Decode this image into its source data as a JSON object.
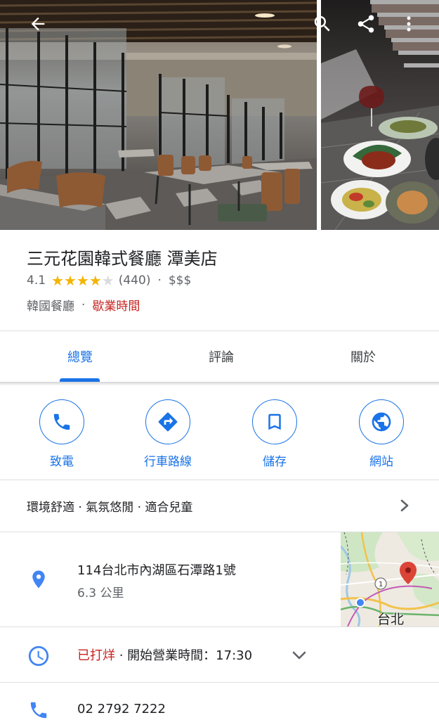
{
  "toolbar": {
    "back_icon": "arrow-back-icon",
    "search_icon": "search-icon",
    "share_icon": "share-icon",
    "more_icon": "more-vert-icon"
  },
  "place": {
    "name": "三元花園韓式餐廳 潭美店",
    "rating": "4.1",
    "stars_filled": 4,
    "reviews": "(440)",
    "price": "$$$",
    "category": "韓國餐廳",
    "hours_link": "歇業時間"
  },
  "tabs": [
    {
      "label": "總覽",
      "active": true
    },
    {
      "label": "評論",
      "active": false
    },
    {
      "label": "關於",
      "active": false
    }
  ],
  "actions": [
    {
      "label": "致電",
      "icon": "phone-icon"
    },
    {
      "label": "行車路線",
      "icon": "directions-icon"
    },
    {
      "label": "儲存",
      "icon": "bookmark-icon"
    },
    {
      "label": "網站",
      "icon": "globe-icon"
    }
  ],
  "atmosphere": "環境舒適 · 氣氛悠閒 · 適合兒童",
  "address": {
    "line": "114台北市內湖區石潭路1號",
    "distance": "6.3 公里",
    "map_label": "台北",
    "map_route_number": "1"
  },
  "hours": {
    "status": "已打烊",
    "detail": " · 開始營業時間：17:30"
  },
  "phone": "02 2792 7222",
  "colors": {
    "accent": "#1a73e8",
    "closed": "#c5221f",
    "star": "#f4b400",
    "pin": "#4285f4"
  }
}
